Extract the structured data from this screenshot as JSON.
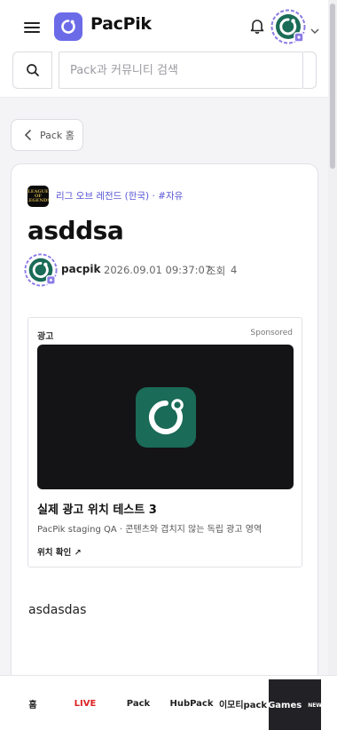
{
  "header": {
    "app_name": "PacPik",
    "search_placeholder": "Pack과 커뮤니티 검색"
  },
  "back_button": {
    "label": "Pack 홈"
  },
  "post": {
    "game_icon_text": "LEAGUE OF LEGENDS",
    "breadcrumb": "리그 오브 레전드 (한국) · #자유",
    "title": "asddsa",
    "author": "pacpik",
    "date": "2026.09.01 09:37:07",
    "views_label": "조회",
    "views_count": "4",
    "body": "asdasdas"
  },
  "ad": {
    "label": "광고",
    "sponsored": "Sponsored",
    "title": "실제 광고 위치 테스트 3",
    "description": "PacPik staging QA · 콘텐츠와 겹치지 않는 독립 광고 영역",
    "link": "위치 확인 ↗"
  },
  "bottom_nav": {
    "items": [
      "홈",
      "LIVE",
      "Pack",
      "HubPack",
      "이모티pack",
      "Games"
    ],
    "games_badge": "NEW"
  },
  "colors": {
    "brand": "#6b6be8",
    "accent_link": "#5855d6",
    "logo_green": "#1a6b57",
    "live_red": "#dd2222"
  }
}
